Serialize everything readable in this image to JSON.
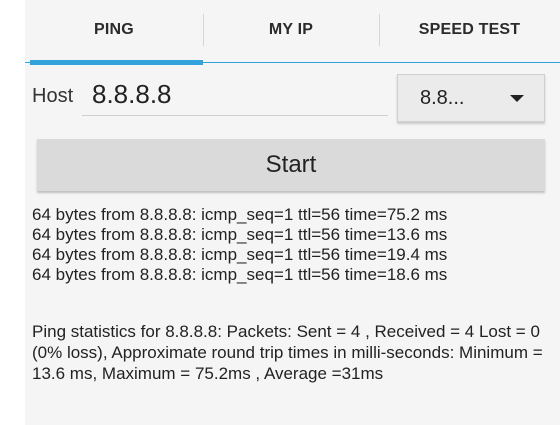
{
  "tabs": [
    {
      "label": "PING",
      "active": true
    },
    {
      "label": "MY IP",
      "active": false
    },
    {
      "label": "SPEED TEST",
      "active": false
    }
  ],
  "accent_color": "#33a3dc",
  "host": {
    "label": "Host",
    "value": "8.8.8.8",
    "dropdown_value": "8.8..."
  },
  "start_label": "Start",
  "output_lines": [
    "64 bytes from 8.8.8.8: icmp_seq=1 ttl=56 time=75.2 ms",
    "64 bytes from 8.8.8.8: icmp_seq=1 ttl=56 time=13.6 ms",
    "64 bytes from 8.8.8.8: icmp_seq=1 ttl=56 time=19.4 ms",
    "64 bytes from 8.8.8.8: icmp_seq=1 ttl=56 time=18.6 ms"
  ],
  "statistics": "Ping statistics for 8.8.8.8: Packets: Sent = 4 , Received = 4 Lost = 0 (0% loss),  Approximate round trip times in milli-seconds:     Minimum = 13.6 ms, Maximum = 75.2ms , Average =31ms",
  "icons": {
    "dropdown": "chevron-down-icon"
  }
}
